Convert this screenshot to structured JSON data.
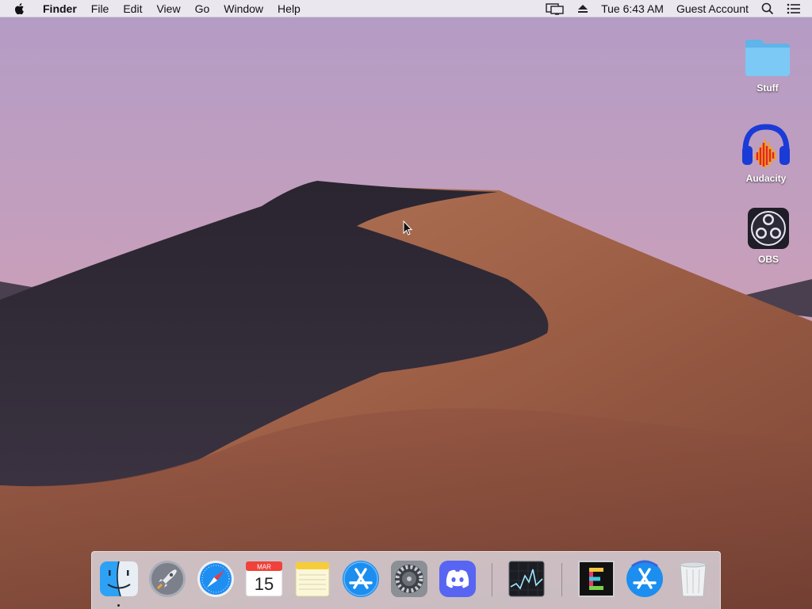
{
  "menubar": {
    "app_name": "Finder",
    "menus": [
      "File",
      "Edit",
      "View",
      "Go",
      "Window",
      "Help"
    ],
    "clock": "Tue 6:43 AM",
    "user": "Guest Account",
    "status_icons": [
      "display-mirroring-icon",
      "eject-icon",
      "search-icon",
      "notification-center-icon"
    ]
  },
  "desktop": {
    "icons": [
      {
        "label": "Stuff",
        "icon": "folder-icon"
      },
      {
        "label": "Audacity",
        "icon": "audacity-icon"
      },
      {
        "label": "OBS",
        "icon": "obs-icon"
      }
    ]
  },
  "dock": {
    "apps": [
      {
        "name": "Finder",
        "icon": "finder-icon",
        "running": true
      },
      {
        "name": "Launchpad",
        "icon": "launchpad-icon",
        "running": false
      },
      {
        "name": "Safari",
        "icon": "safari-icon",
        "running": false
      },
      {
        "name": "Calendar",
        "icon": "calendar-icon",
        "running": false
      },
      {
        "name": "Notes",
        "icon": "notes-icon",
        "running": false
      },
      {
        "name": "App Store",
        "icon": "app-store-icon",
        "running": false
      },
      {
        "name": "System Preferences",
        "icon": "system-preferences-icon",
        "running": false
      },
      {
        "name": "Discord",
        "icon": "discord-icon",
        "running": false
      },
      {
        "name": "Activity Monitor",
        "icon": "activity-monitor-icon",
        "running": false
      },
      {
        "name": "Epic Games",
        "icon": "epic-icon",
        "running": false
      },
      {
        "name": "App Store Download",
        "icon": "app-store-download-icon",
        "running": false
      },
      {
        "name": "Trash",
        "icon": "trash-icon",
        "running": false
      }
    ],
    "calendar_month": "MAR",
    "calendar_day": "15"
  },
  "colors": {
    "sky_top": "#b39cc6",
    "sky_bottom": "#d49ea8",
    "dune_light": "#a86a4e",
    "dune_shadow": "#2b2630",
    "accent_blue": "#1c8ef0"
  }
}
